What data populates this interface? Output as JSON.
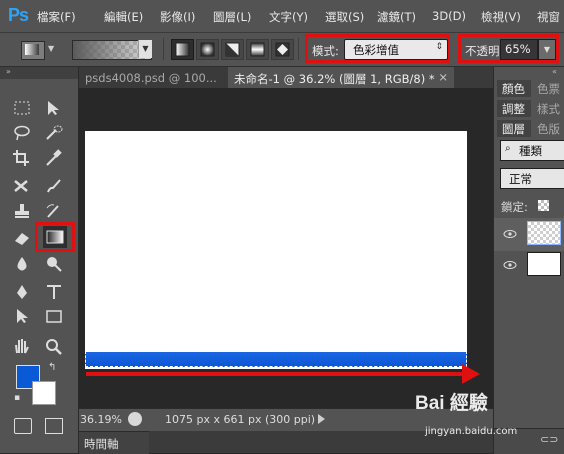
{
  "app": {
    "logo": "Ps"
  },
  "menu": [
    "檔案(F)",
    "編輯(E)",
    "影像(I)",
    "圖層(L)",
    "文字(Y)",
    "選取(S)",
    "濾鏡(T)",
    "3D(D)",
    "檢視(V)",
    "視窗"
  ],
  "options": {
    "mode_label": "模式:",
    "mode_value": "色彩增值",
    "opacity_label": "不透明:",
    "opacity_value": "65%"
  },
  "tabs": [
    {
      "label": "psds4008.psd @ 100..."
    },
    {
      "label": "未命名-1 @ 36.2% (圖層 1, RGB/8) *",
      "close": "×"
    }
  ],
  "status": {
    "zoom": "36.19%",
    "doc_size": "1075 px x 661 px (300 ppi)"
  },
  "timeline_tab": "時間軸",
  "panels": {
    "row1": [
      "顏色",
      "色票"
    ],
    "row2": [
      "調整",
      "樣式"
    ],
    "row3": [
      "圖層",
      "色版"
    ],
    "kind_filter": "種類",
    "blend_mode": "正常",
    "lock_label": "鎖定:"
  },
  "colors": {
    "foreground": "#0a5ad8",
    "background": "#ffffff",
    "highlight": "#e01010"
  },
  "watermark": {
    "logo": "Bai 經驗",
    "url": "jingyan.baidu.com"
  }
}
